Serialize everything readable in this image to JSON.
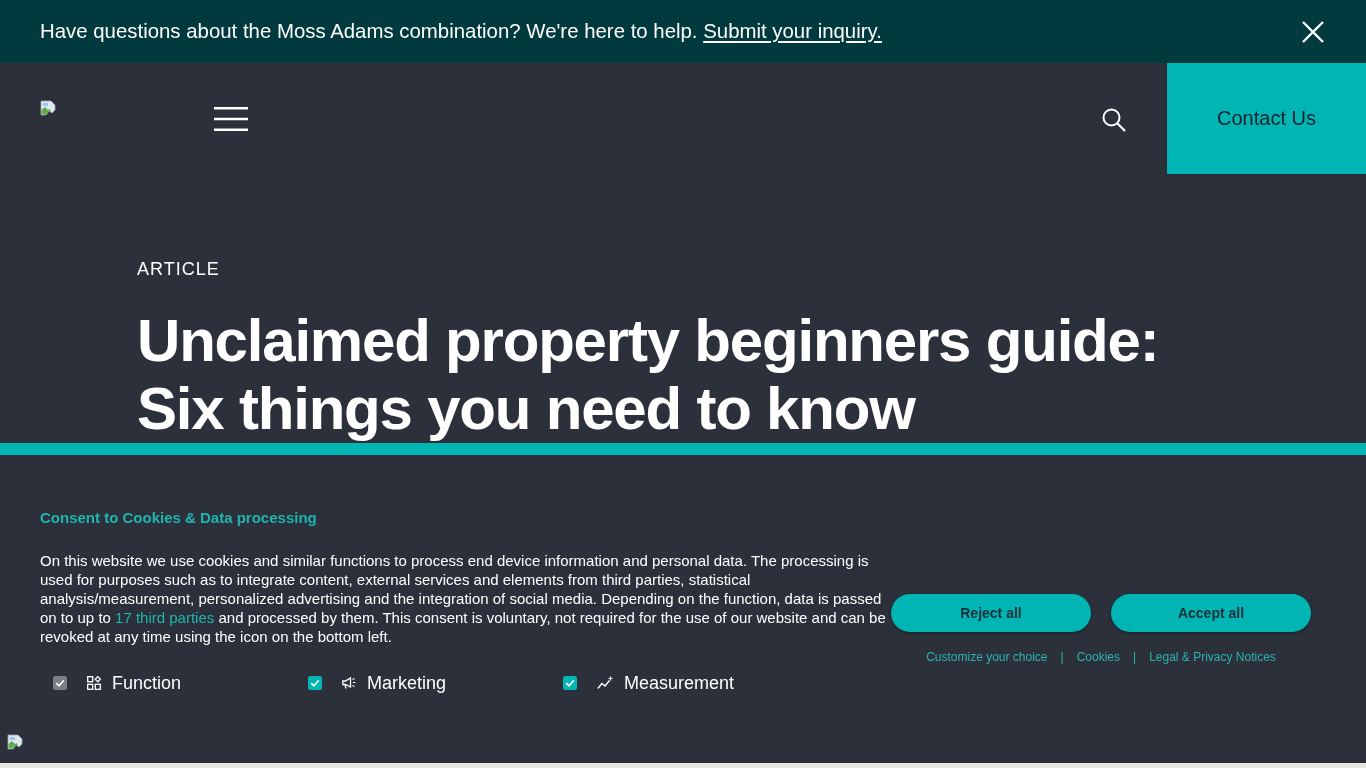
{
  "announcement_bar": {
    "text": "Have questions about the Moss Adams combination? We're here to help.",
    "link": "Submit your inquiry."
  },
  "header": {
    "contact_button": "Contact Us"
  },
  "hero": {
    "eyebrow": "ARTICLE",
    "title": "Unclaimed property beginners guide: Six things you need to know"
  },
  "cookie_consent": {
    "title": "Consent to Cookies & Data processing",
    "text_before_link": "On this website we use cookies and similar functions to process end device information and personal data. The processing is used for purposes such as to integrate content, external services and elements from third parties, statistical analysis/measurement, personalized advertising and the integration of social media. Depending on the function, data is passed on to up to",
    "link": "17 third parties",
    "text_after_link": "and processed by them. This consent is voluntary, not required for the use of our website and can be revoked at any time using the icon on the bottom left.",
    "categories": [
      {
        "label": "Function",
        "checked": true,
        "disabled": true
      },
      {
        "label": "Marketing",
        "checked": true,
        "disabled": false
      },
      {
        "label": "Measurement",
        "checked": true,
        "disabled": false
      }
    ],
    "buttons": [
      "Reject all",
      "Accept all"
    ],
    "footer_links": [
      "Customize your choice",
      "Cookies",
      "Legal & Privacy Notices"
    ],
    "link_separators": [
      "|",
      "|"
    ]
  }
}
